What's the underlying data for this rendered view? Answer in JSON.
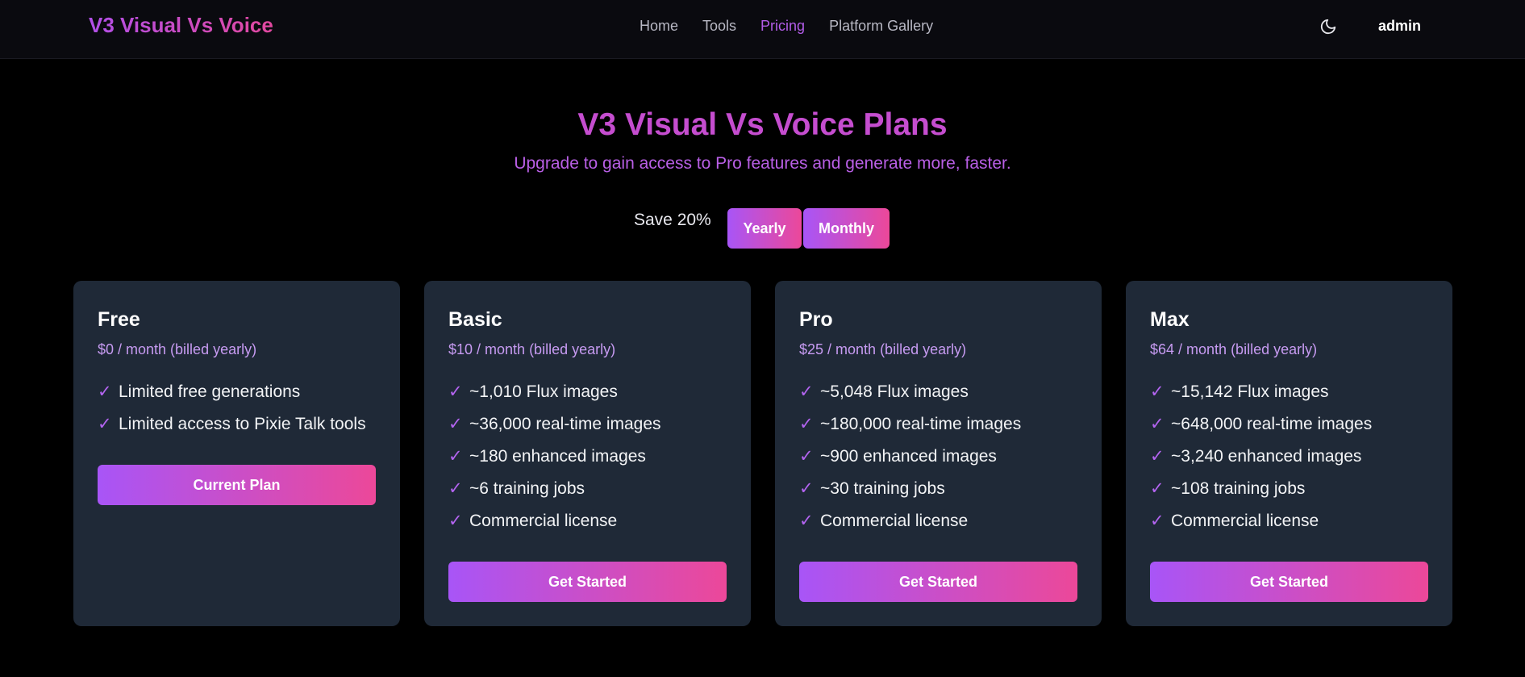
{
  "nav": {
    "brand": "V3 Visual Vs Voice",
    "links": [
      {
        "label": "Home"
      },
      {
        "label": "Tools"
      },
      {
        "label": "Pricing",
        "active": true
      },
      {
        "label": "Platform Gallery"
      }
    ],
    "theme_icon": "moon-icon",
    "user": "admin"
  },
  "hero": {
    "title": "V3 Visual Vs Voice Plans",
    "subtitle": "Upgrade to gain access to Pro features and generate more, faster."
  },
  "billing": {
    "save_label": "Save 20%",
    "yearly_label": "Yearly",
    "monthly_label": "Monthly",
    "selected": "Yearly"
  },
  "plans": [
    {
      "name": "Free",
      "price": "$0 / month (billed yearly)",
      "features": [
        "Limited free generations",
        "Limited access to Pixie Talk tools"
      ],
      "button": "Current Plan"
    },
    {
      "name": "Basic",
      "price": "$10 / month (billed yearly)",
      "features": [
        "~1,010 Flux images",
        "~36,000 real-time images",
        "~180 enhanced images",
        "~6 training jobs",
        "Commercial license"
      ],
      "button": "Get Started"
    },
    {
      "name": "Pro",
      "price": "$25 / month (billed yearly)",
      "features": [
        "~5,048 Flux images",
        "~180,000 real-time images",
        "~900 enhanced images",
        "~30 training jobs",
        "Commercial license"
      ],
      "button": "Get Started"
    },
    {
      "name": "Max",
      "price": "$64 / month (billed yearly)",
      "features": [
        "~15,142 Flux images",
        "~648,000 real-time images",
        "~3,240 enhanced images",
        "~108 training jobs",
        "Commercial license"
      ],
      "button": "Get Started"
    }
  ],
  "check_glyph": "✓",
  "colors": {
    "background": "#000000",
    "navbar": "#0a0a0f",
    "card": "#1f2937",
    "accent_start": "#a855f7",
    "accent_end": "#ec4899",
    "active_link": "#b25ce8"
  }
}
